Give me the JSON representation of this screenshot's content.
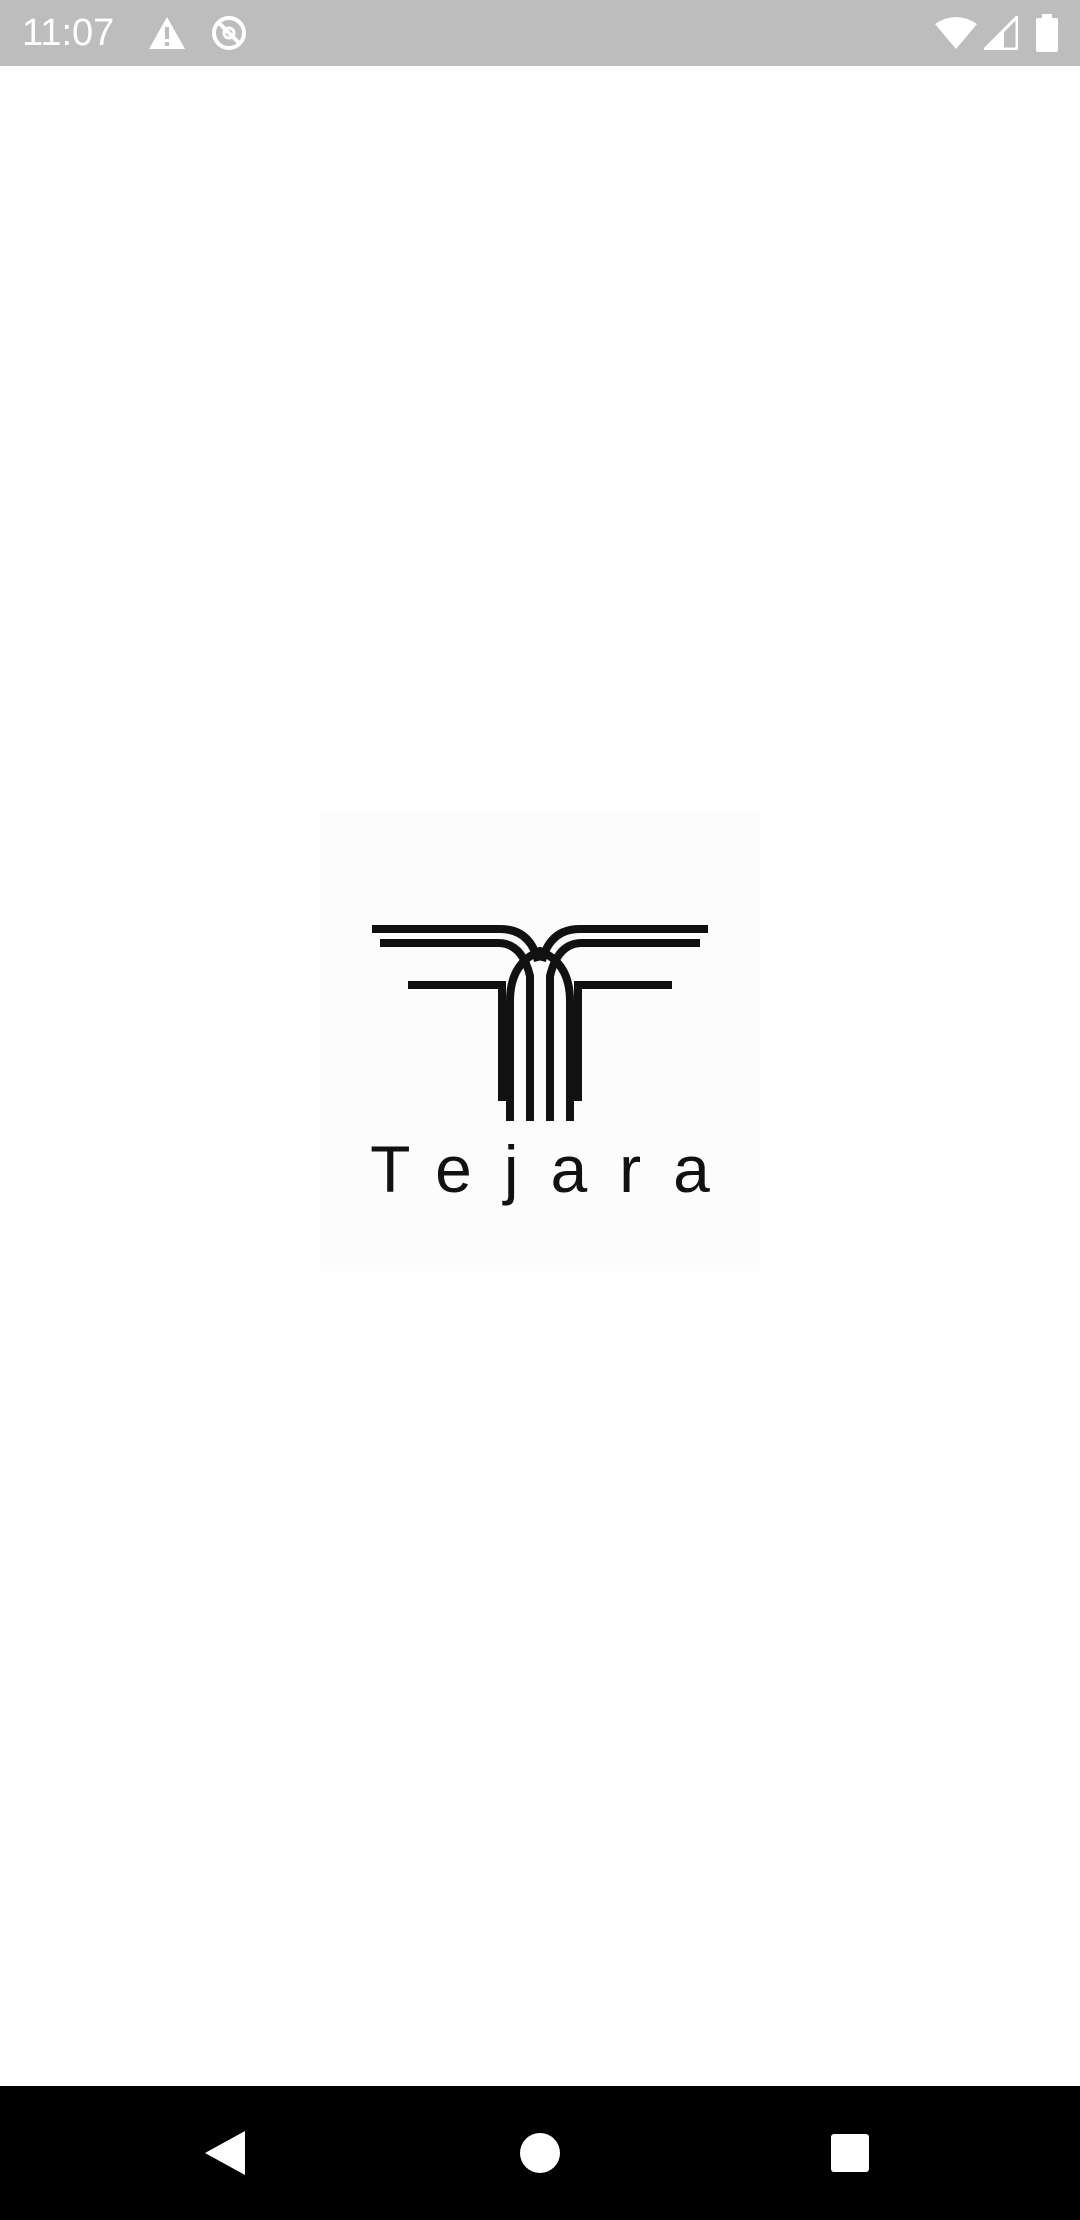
{
  "status_bar": {
    "time": "11:07",
    "icons_left": [
      "warning-icon",
      "blocked-icon"
    ],
    "icons_right": [
      "wifi-icon",
      "cell-signal-icon",
      "battery-icon"
    ]
  },
  "splash": {
    "app_name": "Tejara"
  },
  "nav_bar": {
    "buttons": [
      "back-icon",
      "home-icon",
      "recents-icon"
    ]
  },
  "colors": {
    "status_bar_bg": "#bdbdbd",
    "background": "#ffffff",
    "nav_bar_bg": "#000000",
    "logo_ink": "#111111"
  }
}
